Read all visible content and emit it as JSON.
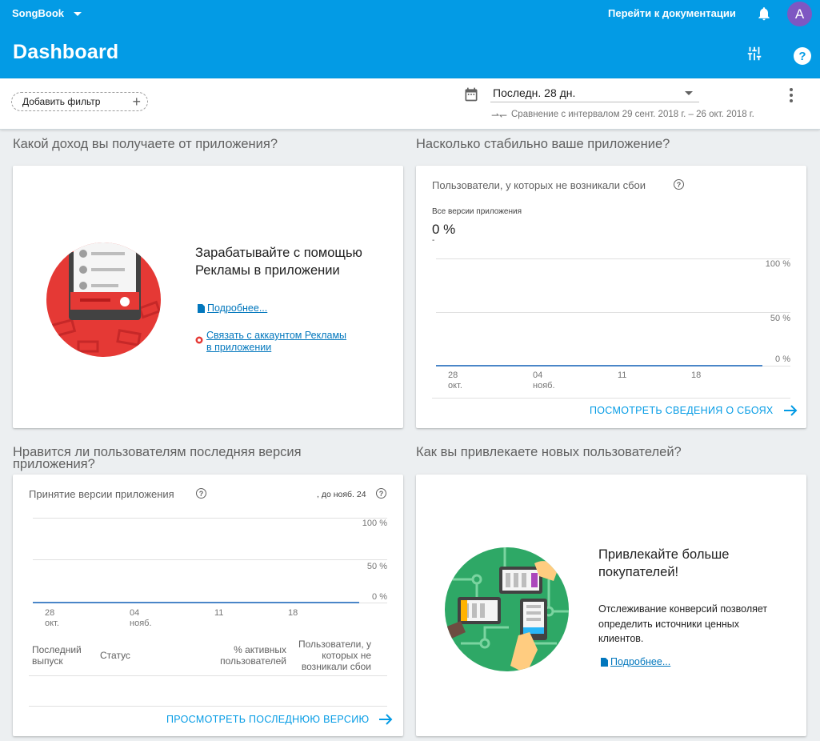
{
  "topbar": {
    "project": "SongBook",
    "docs_link": "Перейти к документации",
    "avatar_letter": "A",
    "title": "Dashboard",
    "help": "?"
  },
  "filters": {
    "add_filter": "Добавить фильтр",
    "date_range": "Последн. 28 дн.",
    "comparison": "Сравнение с интервалом 29 сент. 2018 г. – 26 окт. 2018 г."
  },
  "sections": {
    "revenue": "Какой доход вы получаете от приложения?",
    "stability": "Насколько стабильно ваше приложение?",
    "latest_release": "Нравится ли пользователям последняя версия приложения?",
    "acquisition": "Как вы привлекаете новых пользователей?"
  },
  "revenue_card": {
    "heading_line1": "Зарабатывайте с помощью",
    "heading_line2": "Рекламы в приложении",
    "learn_more": "Подробнее...",
    "link_line1": "Связать с аккаунтом Рекламы",
    "link_line2": "в приложении"
  },
  "stability_card": {
    "subtitle": "Пользователи, у которых не возникали сбои",
    "help": "?",
    "version_label": "Все версии приложения",
    "value": "0 %",
    "value_delta": "-",
    "y_ticks": [
      "100 %",
      "50 %",
      "0 %"
    ],
    "x_ticks": [
      {
        "day": "28",
        "month": "окт."
      },
      {
        "day": "04",
        "month": "нояб."
      },
      {
        "day": "11",
        "month": ""
      },
      {
        "day": "18",
        "month": ""
      }
    ],
    "action": "ПОСМОТРЕТЬ СВЕДЕНИЯ О СБОЯХ"
  },
  "release_card": {
    "subtitle": "Принятие версии приложения",
    "help": "?",
    "date_note": ", до нояб. 24",
    "y_ticks": [
      "100 %",
      "50 %",
      "0 %"
    ],
    "x_ticks": [
      {
        "day": "28",
        "month": "окт."
      },
      {
        "day": "04",
        "month": "нояб."
      },
      {
        "day": "11",
        "month": ""
      },
      {
        "day": "18",
        "month": ""
      }
    ],
    "table_headers": {
      "last_release_1": "Последний",
      "last_release_2": "выпуск",
      "status": "Статус",
      "active_1": "% активных",
      "active_2": "пользователей",
      "crashfree_1": "Пользователи, у",
      "crashfree_2": "которых не",
      "crashfree_3": "возникали сбои"
    },
    "action": "ПРОСМОТРЕТЬ ПОСЛЕДНЮЮ ВЕРСИЮ"
  },
  "acquisition_card": {
    "heading_line1": "Привлекайте больше",
    "heading_line2": "покупателей!",
    "body_line1": "Отслеживание конверсий позволяет",
    "body_line2": "определить источники ценных",
    "body_line3": "клиентов.",
    "learn_more": "Подробнее..."
  },
  "colors": {
    "appbar": "#039be5",
    "accent": "#039be5",
    "series": "#4a86c8",
    "avatar": "#7e57c2",
    "ads_red": "#e53935",
    "acq_green": "#2ea866"
  }
}
